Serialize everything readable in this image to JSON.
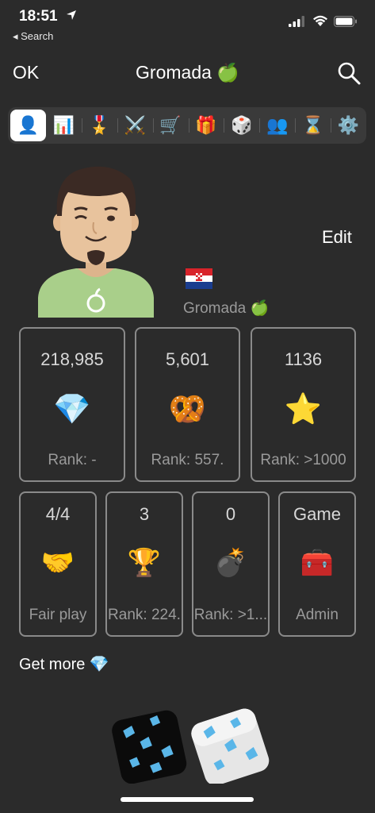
{
  "status_bar": {
    "time": "18:51",
    "back_label": "◂ Search"
  },
  "nav": {
    "ok_label": "OK",
    "title": "Gromada 🍏"
  },
  "tabs": [
    {
      "icon": "👤",
      "name": "profile"
    },
    {
      "icon": "📊",
      "name": "stats"
    },
    {
      "icon": "🎖️",
      "name": "medals"
    },
    {
      "icon": "⚔️",
      "name": "battles"
    },
    {
      "icon": "🛒",
      "name": "shop"
    },
    {
      "icon": "🎁",
      "name": "gifts"
    },
    {
      "icon": "🎲",
      "name": "dice"
    },
    {
      "icon": "👥",
      "name": "friends"
    },
    {
      "icon": "⌛",
      "name": "history"
    },
    {
      "icon": "⚙️",
      "name": "settings"
    }
  ],
  "profile": {
    "edit_label": "Edit",
    "name": "Gromada 🍏"
  },
  "stats_big": [
    {
      "value": "218,985",
      "icon": "💎",
      "label": "Rank: -"
    },
    {
      "value": "5,601",
      "icon": "🥨",
      "label": "Rank: 557."
    },
    {
      "value": "1136",
      "icon": "⭐",
      "label": "Rank: >1000"
    }
  ],
  "stats_small": [
    {
      "value": "4/4",
      "icon": "🤝",
      "label": "Fair play"
    },
    {
      "value": "3",
      "icon": "🏆",
      "label": "Rank: 224."
    },
    {
      "value": "0",
      "icon": "💣",
      "label": "Rank: >1..."
    },
    {
      "value": "Game",
      "icon": "🧰",
      "label": "Admin"
    }
  ],
  "get_more": "Get more 💎",
  "colors": {
    "background": "#2b2b2b",
    "card_border": "#8a8a8a",
    "muted_text": "#9a9a9a",
    "shirt": "#a8d08a"
  }
}
